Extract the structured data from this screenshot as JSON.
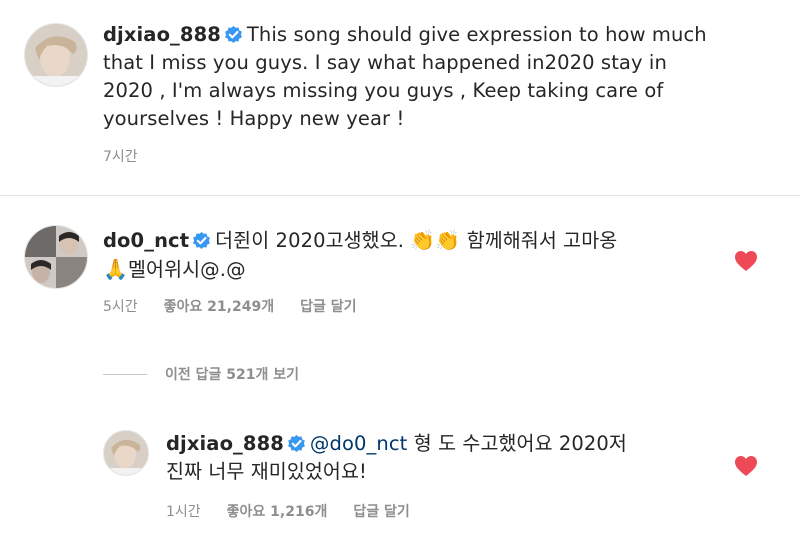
{
  "caption": {
    "username": "djxiao_888",
    "text_line1": "This song should give expression to how much",
    "text_line2": "that I miss you guys. I say what happened in2020 stay in",
    "text_line3": "2020 , I'm always missing you guys , Keep taking care of",
    "text_line4": "yourselves ! Happy new year !",
    "time": "7시간"
  },
  "comment": {
    "username": "do0_nct",
    "text_part1": "더쥔이 2020고생했오.",
    "emoji1": "👏👏",
    "text_part2": "함께해줘서 고마옹",
    "emoji2": "🙏",
    "text_line2": "멜어위시@.@",
    "time": "5시간",
    "likes": "좋아요 21,249개",
    "reply_label": "답글 달기",
    "liked": true
  },
  "view_replies": {
    "label": "이전 답글 521개 보기"
  },
  "reply": {
    "username": "djxiao_888",
    "mention": "@do0_nct",
    "text_part1": "형 도 수고했어요 2020저",
    "text_line2": "진짜 너무 재미있었어요!",
    "time": "1시간",
    "likes": "좋아요 1,216개",
    "reply_label": "답글 달기",
    "liked": true
  },
  "colors": {
    "heart": "#ed4956",
    "verified": "#3897f0",
    "meta": "#8e8e8e",
    "mention": "#00376b"
  },
  "icons": [
    "verified-badge-icon",
    "heart-icon"
  ]
}
